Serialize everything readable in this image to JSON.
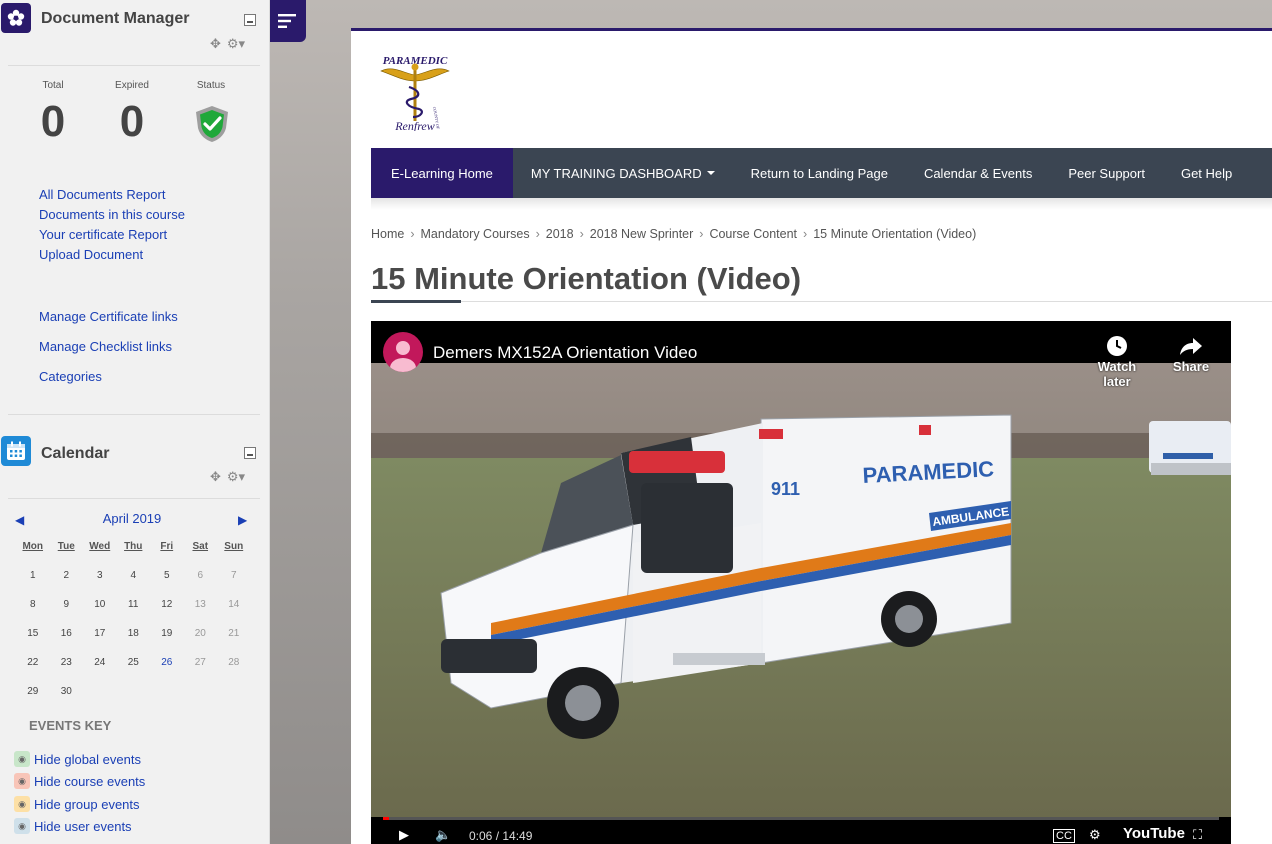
{
  "document_manager": {
    "title": "Document Manager",
    "stats": [
      {
        "label": "Total",
        "value": "0"
      },
      {
        "label": "Expired",
        "value": "0"
      },
      {
        "label": "Status",
        "value": ""
      }
    ],
    "links": [
      "All Documents Report",
      "Documents in this course",
      "Your certificate Report",
      "Upload Document"
    ],
    "manage_links": [
      "Manage Certificate links",
      "Manage Checklist links",
      "Categories"
    ]
  },
  "calendar": {
    "title": "Calendar",
    "month": "April 2019",
    "day_headers": [
      "Mon",
      "Tue",
      "Wed",
      "Thu",
      "Fri",
      "Sat",
      "Sun"
    ],
    "weeks": [
      [
        "1",
        "2",
        "3",
        "4",
        "5",
        "6",
        "7"
      ],
      [
        "8",
        "9",
        "10",
        "11",
        "12",
        "13",
        "14"
      ],
      [
        "15",
        "16",
        "17",
        "18",
        "19",
        "20",
        "21"
      ],
      [
        "22",
        "23",
        "24",
        "25",
        "26",
        "27",
        "28"
      ],
      [
        "29",
        "30",
        "",
        "",
        "",
        "",
        ""
      ]
    ],
    "today": "26",
    "events_key_title": "EVENTS KEY",
    "events_key": [
      {
        "label": "Hide global events",
        "color": "#c8e6c9"
      },
      {
        "label": "Hide course events",
        "color": "#f8c5b8"
      },
      {
        "label": "Hide group events",
        "color": "#fde0a6"
      },
      {
        "label": "Hide user events",
        "color": "#cfe0ea"
      }
    ]
  },
  "logo": {
    "top_text": "PARAMEDIC",
    "bottom_text": "Renfrew",
    "arc_text": "COUNTY OF"
  },
  "nav": {
    "items": [
      {
        "label": "E-Learning Home",
        "active": true
      },
      {
        "label": "MY TRAINING DASHBOARD",
        "dropdown": true
      },
      {
        "label": "Return to Landing Page"
      },
      {
        "label": "Calendar & Events"
      },
      {
        "label": "Peer Support"
      },
      {
        "label": "Get Help"
      }
    ]
  },
  "breadcrumb": [
    "Home",
    "Mandatory Courses",
    "2018",
    "2018 New Sprinter",
    "Course Content",
    "15 Minute Orientation (Video)"
  ],
  "page_title": "15 Minute Orientation (Video)",
  "video": {
    "title": "Demers MX152A Orientation Video",
    "watch_later": "Watch later",
    "share": "Share",
    "time": "0:06 / 14:49",
    "progress": 0.0067,
    "brand": "YouTube",
    "ambulance_text": "PARAMEDIC",
    "ambulance_number": "911",
    "ambulance_label": "AMBULANCE"
  }
}
